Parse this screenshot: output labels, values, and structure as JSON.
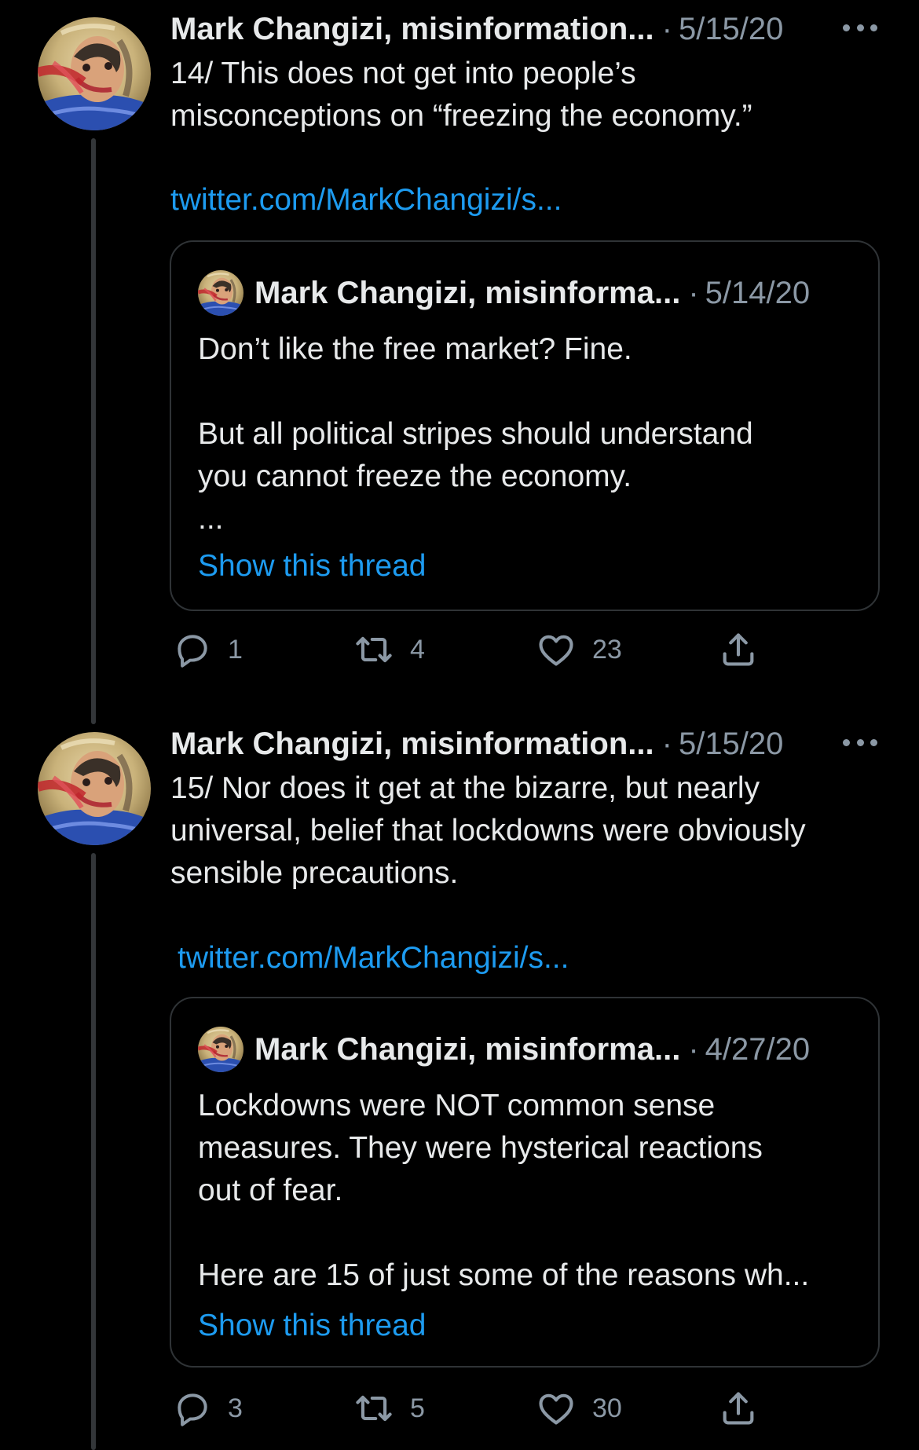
{
  "tweets": [
    {
      "author": "Mark Changizi, misinformation...",
      "date": "5/15/20",
      "text": "14/ This does not get into people’s\nmisconceptions on “freezing the economy.”",
      "link": "twitter.com/MarkChangizi/s...",
      "quote": {
        "author": "Mark Changizi, misinforma...",
        "date": "5/14/20",
        "text": "Don’t like the free market? Fine.\n\nBut all political stripes should understand\nyou cannot freeze the economy.\n...",
        "show_thread": "Show this thread"
      },
      "actions": {
        "replies": "1",
        "retweets": "4",
        "likes": "23"
      }
    },
    {
      "author": "Mark Changizi, misinformation...",
      "date": "5/15/20",
      "text": "15/ Nor does it get at the bizarre, but nearly\nuniversal, belief that lockdowns were obviously\nsensible precautions.",
      "link": "twitter.com/MarkChangizi/s...",
      "quote": {
        "author": "Mark Changizi, misinforma...",
        "date": "4/27/20",
        "text": "Lockdowns were NOT common sense\nmeasures. They were hysterical reactions\nout of fear.\n\nHere are 15 of just some of the reasons wh...",
        "show_thread": "Show this thread"
      },
      "actions": {
        "replies": "3",
        "retweets": "5",
        "likes": "30"
      }
    }
  ],
  "colors": {
    "background": "#000000",
    "text": "#e7e9ea",
    "secondary": "#8b98a5",
    "link": "#1d9bf0",
    "border": "#2f3336"
  },
  "icons": {
    "reply": "reply-icon",
    "retweet": "retweet-icon",
    "like": "heart-icon",
    "share": "share-icon",
    "more": "more-icon"
  }
}
